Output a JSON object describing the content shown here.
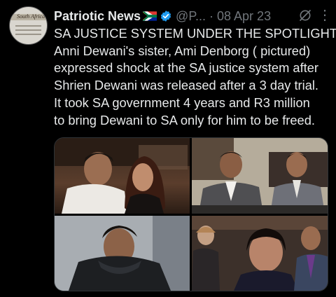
{
  "tweet": {
    "author_name": "Patriotic News",
    "handle": "@P...",
    "separator": "·",
    "date": "08 Apr 23",
    "avatar_text": "South Africa",
    "text_lines": [
      "SA JUSTICE SYSTEM UNDER THE SPOTLIGHT",
      "Anni Dewani's sister, Ami Denborg ( pictured)",
      "expressed shock at the SA justice system after",
      "Shrien Dewani was released after a 3 day trial.",
      "It took SA government 4 years and R3 million",
      "to bring Dewani to SA only for him to be freed."
    ],
    "more_icon": "⋮"
  },
  "colors": {
    "background": "#000000",
    "text": "#e7e9ea",
    "muted": "#71767b",
    "verified": "#1d9bf0"
  },
  "icons": [
    "south-africa-flag-icon",
    "verified-badge-icon",
    "grok-icon",
    "more-options-icon"
  ]
}
